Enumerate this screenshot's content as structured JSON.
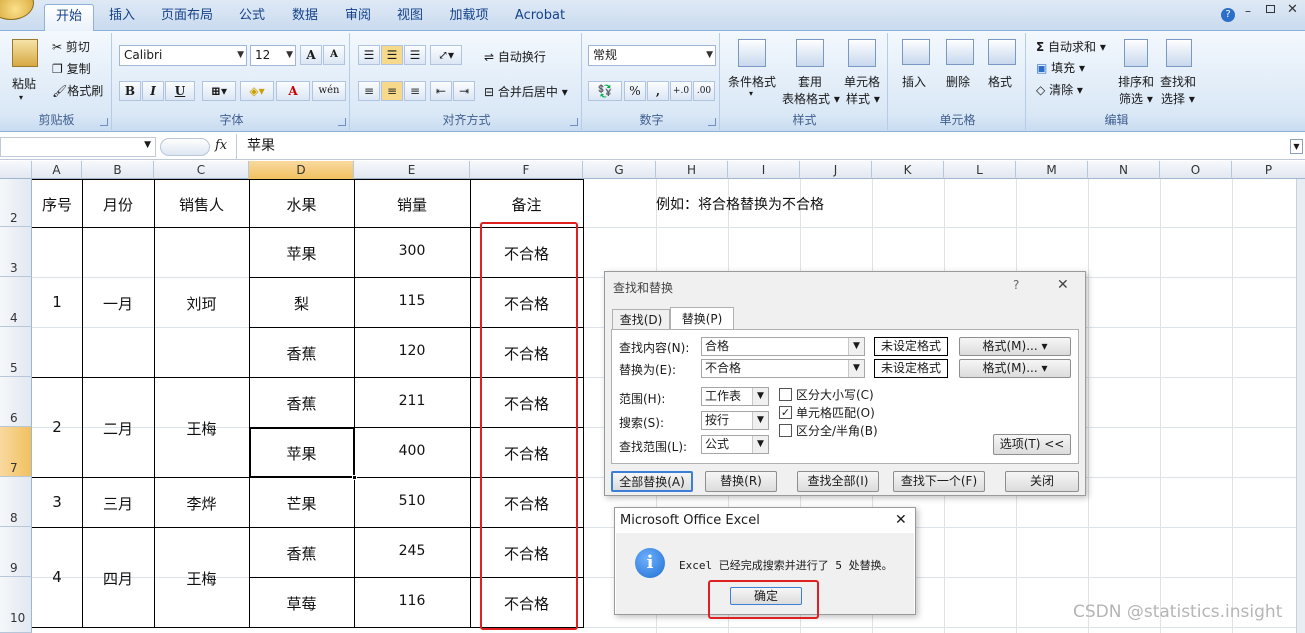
{
  "ribbon_tabs": [
    "开始",
    "插入",
    "页面布局",
    "公式",
    "数据",
    "审阅",
    "视图",
    "加载项",
    "Acrobat"
  ],
  "clipboard": {
    "paste": "粘贴",
    "cut": "剪切",
    "copy": "复制",
    "format_painter": "格式刷",
    "group": "剪贴板"
  },
  "font": {
    "name": "Calibri",
    "size": "12",
    "bold": "B",
    "italic": "I",
    "underline": "U",
    "grow": "A",
    "shrink": "A",
    "font_color_letter": "A",
    "wen": "wén",
    "group": "字体"
  },
  "alignment": {
    "wrap": "自动换行",
    "merge": "合并后居中",
    "group": "对齐方式"
  },
  "number": {
    "format": "常规",
    "percent": "%",
    "comma": ",",
    "inc": "+.0",
    "dec": ".00",
    "group": "数字"
  },
  "styles": {
    "conditional": "条件格式",
    "table_1": "套用",
    "table_2": "表格格式",
    "cell_style_1": "单元格",
    "cell_style_2": "样式",
    "group": "样式"
  },
  "cells": {
    "insert": "插入",
    "delete": "删除",
    "format": "格式",
    "group": "单元格"
  },
  "editing": {
    "autosum": "自动求和",
    "fill": "填充",
    "clear": "清除",
    "sort_1": "排序和",
    "sort_2": "筛选",
    "find_1": "查找和",
    "find_2": "选择",
    "group": "编辑"
  },
  "formula_bar": {
    "fx": "fx",
    "content": "苹果"
  },
  "columns": [
    "A",
    "B",
    "C",
    "D",
    "E",
    "F",
    "G",
    "H",
    "I",
    "J",
    "K",
    "L",
    "M",
    "N",
    "O",
    "P"
  ],
  "rows": [
    "2",
    "3",
    "4",
    "5",
    "6",
    "7",
    "8",
    "9",
    "10"
  ],
  "table": {
    "headers": [
      "序号",
      "月份",
      "销售人",
      "水果",
      "销量",
      "备注"
    ],
    "groups": [
      {
        "id": "1",
        "month": "一月",
        "seller": "刘珂"
      },
      {
        "id": "2",
        "month": "二月",
        "seller": "王梅"
      },
      {
        "id": "3",
        "month": "三月",
        "seller": "李烨"
      },
      {
        "id": "4",
        "month": "四月",
        "seller": "王梅"
      }
    ],
    "fruits": [
      "苹果",
      "梨",
      "香蕉",
      "香蕉",
      "苹果",
      "芒果",
      "香蕉",
      "草莓"
    ],
    "qty": [
      "300",
      "115",
      "120",
      "211",
      "400",
      "510",
      "245",
      "116"
    ],
    "notes": [
      "不合格",
      "不合格",
      "不合格",
      "不合格",
      "不合格",
      "不合格",
      "不合格",
      "不合格"
    ]
  },
  "example_note": "例如：将合格替换为不合格",
  "find_dialog": {
    "title": "查找和替换",
    "help": "?",
    "close": "✕",
    "tab_find": "查找(D)",
    "tab_replace": "替换(P)",
    "find_label": "查找内容(N):",
    "find_value": "合格",
    "replace_label": "替换为(E):",
    "replace_value": "不合格",
    "no_format": "未设定格式",
    "format_btn": "格式(M)...",
    "within_label": "范围(H):",
    "within_value": "工作表",
    "search_label": "搜索(S):",
    "search_value": "按行",
    "lookin_label": "查找范围(L):",
    "lookin_value": "公式",
    "match_case": "区分大小写(C)",
    "match_cell": "单元格匹配(O)",
    "match_byte": "区分全/半角(B)",
    "match_case_checked": false,
    "match_cell_checked": true,
    "match_byte_checked": false,
    "options_btn": "选项(T) <<",
    "replace_all": "全部替换(A)",
    "replace": "替换(R)",
    "find_all": "查找全部(I)",
    "find_next": "查找下一个(F)",
    "close_btn": "关闭"
  },
  "msg_dialog": {
    "title": "Microsoft Office Excel",
    "close": "✕",
    "icon": "i",
    "message": "Excel 已经完成搜索并进行了 5 处替换。",
    "ok": "确定"
  },
  "watermark": "CSDN @statistics.insight",
  "colors": {
    "highlight": "#e02020",
    "selected_header": "#f5c66a",
    "ribbon_text": "#15428b",
    "info_icon": "#1e6fd0"
  }
}
